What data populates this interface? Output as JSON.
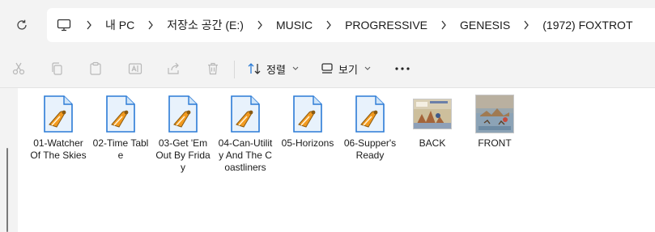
{
  "address_bar": {
    "crumbs": [
      "내 PC",
      "저장소 공간 (E:)",
      "MUSIC",
      "PROGRESSIVE",
      "GENESIS",
      "(1972) FOXTROT"
    ]
  },
  "toolbar": {
    "sort_label": "정렬",
    "view_label": "보기"
  },
  "files": [
    {
      "name": "01-Watcher Of The Skies",
      "type": "audio"
    },
    {
      "name": "02-Time Table",
      "type": "audio"
    },
    {
      "name": "03-Get 'Em Out By Friday",
      "type": "audio"
    },
    {
      "name": "04-Can-Utility And The Coastliners",
      "type": "audio"
    },
    {
      "name": "05-Horizons",
      "type": "audio"
    },
    {
      "name": "06-Supper's Ready",
      "type": "audio"
    },
    {
      "name": "BACK",
      "type": "image"
    },
    {
      "name": "FRONT",
      "type": "image"
    }
  ],
  "colors": {
    "accent_orange": "#f29a1f",
    "icon_blue": "#2b7bd6",
    "disabled_icon": "#b8b8b8"
  }
}
